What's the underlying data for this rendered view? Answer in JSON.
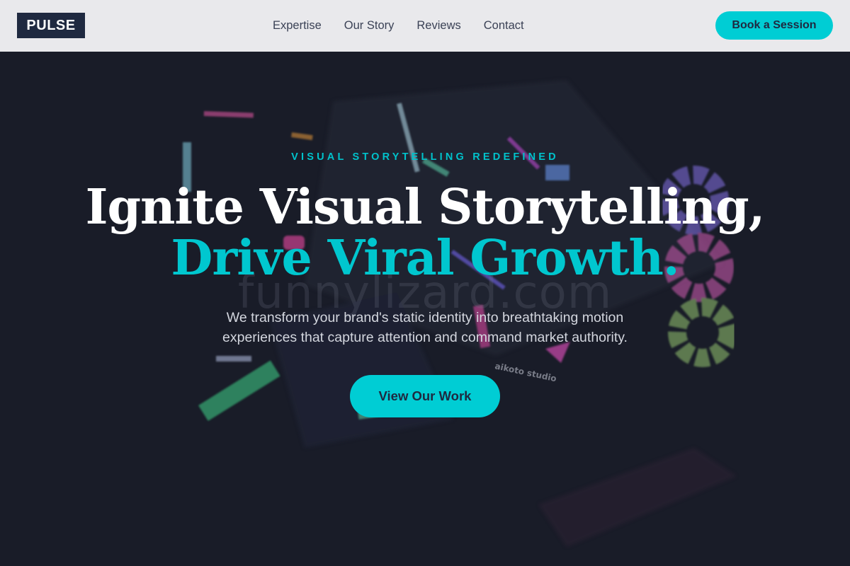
{
  "brand": {
    "logo_text": "PULSE"
  },
  "nav": {
    "items": [
      "Expertise",
      "Our Story",
      "Reviews",
      "Contact"
    ]
  },
  "header": {
    "cta_label": "Book a Session"
  },
  "hero": {
    "eyebrow": "VISUAL STORYTELLING REDEFINED",
    "headline_line1": "Ignite Visual Storytelling,",
    "headline_line2": "Drive Viral Growth.",
    "subtitle": "We transform your brand's static identity into breathtaking motion experiences that capture attention and command market authority.",
    "cta_label": "View Our Work",
    "watermark": "funnylizard.com",
    "image_label": "aikoto studio"
  },
  "colors": {
    "accent": "#00cdd4",
    "dark": "#1f2940",
    "background": "#191c28",
    "header_bg": "#e9e9ec"
  }
}
